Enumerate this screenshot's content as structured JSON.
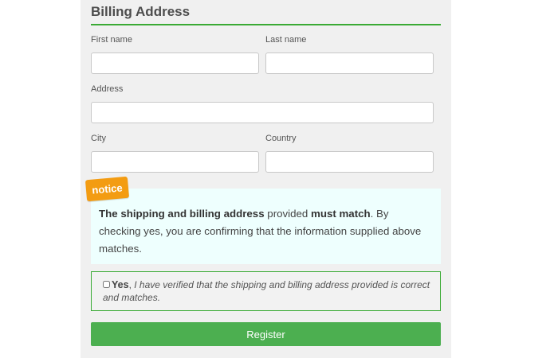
{
  "form": {
    "title": "Billing Address",
    "first_name_label": "First name",
    "first_name_value": "",
    "last_name_label": "Last name",
    "last_name_value": "",
    "address_label": "Address",
    "address_value": "",
    "city_label": "City",
    "city_value": "",
    "country_label": "Country",
    "country_value": ""
  },
  "notice": {
    "tag": "notice",
    "bold1": "The shipping and billing address",
    "text1": " provided ",
    "bold2": "must match",
    "text2": ". By checking yes, you are confirming that the information supplied above matches."
  },
  "confirm": {
    "yes_label": "Yes",
    "comma": ", ",
    "statement": "I have verified that the shipping and billing address provided is correct and matches."
  },
  "actions": {
    "register_label": "Register"
  },
  "colors": {
    "accent_green": "#3aaa35",
    "button_green": "#4caf50",
    "notice_orange": "#f39c12",
    "notice_bg": "#eefffe"
  }
}
